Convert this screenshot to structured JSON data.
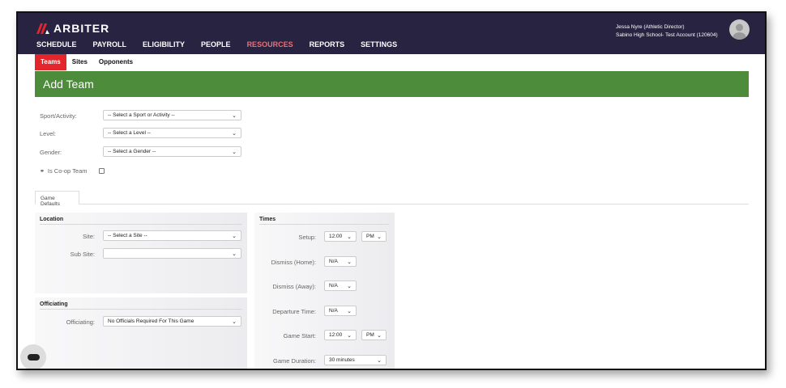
{
  "brand": {
    "name": "ARBITER",
    "accent": "#e3262b",
    "nav_bg": "#272341",
    "header_green": "#4c8c3a"
  },
  "nav": {
    "items": [
      "SCHEDULE",
      "PAYROLL",
      "ELIGIBILITY",
      "PEOPLE",
      "RESOURCES",
      "REPORTS",
      "SETTINGS"
    ],
    "active": "RESOURCES"
  },
  "user": {
    "name": "Jessa Nyre (Athletic Director)",
    "account": "Sabino High School- Test Account (120604)"
  },
  "subnav": {
    "items": [
      "Teams",
      "Sites",
      "Opponents"
    ],
    "active": "Teams"
  },
  "page_title": "Add Team",
  "form": {
    "sport": {
      "label": "Sport/Activity:",
      "value": "-- Select a Sport or Activity --"
    },
    "level": {
      "label": "Level:",
      "value": "-- Select a Level --"
    },
    "gender": {
      "label": "Gender:",
      "value": "-- Select a Gender --"
    },
    "coop": {
      "label": "Is Co-op Team",
      "icon": "handshake-icon",
      "checked": false
    }
  },
  "tabs": [
    "Game Defaults"
  ],
  "location": {
    "title": "Location",
    "site": {
      "label": "Site:",
      "value": "-- Select a Site --"
    },
    "subsite": {
      "label": "Sub Site:",
      "value": ""
    }
  },
  "officiating": {
    "title": "Officiating",
    "field": {
      "label": "Officiating:",
      "value": "No Officials Required For This Game"
    }
  },
  "times": {
    "title": "Times",
    "setup": {
      "label": "Setup:",
      "time": "12:00",
      "ampm": "PM"
    },
    "dismiss_home": {
      "label": "Dismiss (Home):",
      "value": "N/A"
    },
    "dismiss_away": {
      "label": "Dismiss (Away):",
      "value": "N/A"
    },
    "departure": {
      "label": "Departure Time:",
      "value": "N/A"
    },
    "game_start": {
      "label": "Game Start:",
      "time": "12:00",
      "ampm": "PM"
    },
    "duration": {
      "label": "Game Duration:",
      "value": "30 minutes"
    }
  }
}
